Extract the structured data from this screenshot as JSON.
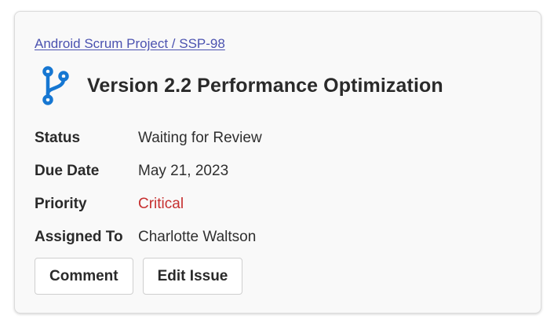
{
  "issue": {
    "breadcrumb": "Android Scrum Project / SSP-98",
    "icon": "branch-icon",
    "title": "Version 2.2 Performance Optimization",
    "fields": [
      {
        "label": "Status",
        "value": "Waiting for Review"
      },
      {
        "label": "Due Date",
        "value": "May 21, 2023"
      },
      {
        "label": "Priority",
        "value": "Critical"
      },
      {
        "label": "Assigned To",
        "value": "Charlotte Waltson"
      }
    ]
  },
  "actions": {
    "comment_label": "Comment",
    "edit_label": "Edit Issue"
  },
  "colors": {
    "link": "#4b52b0",
    "icon": "#1677d2",
    "priority_critical": "#c62f2f"
  }
}
